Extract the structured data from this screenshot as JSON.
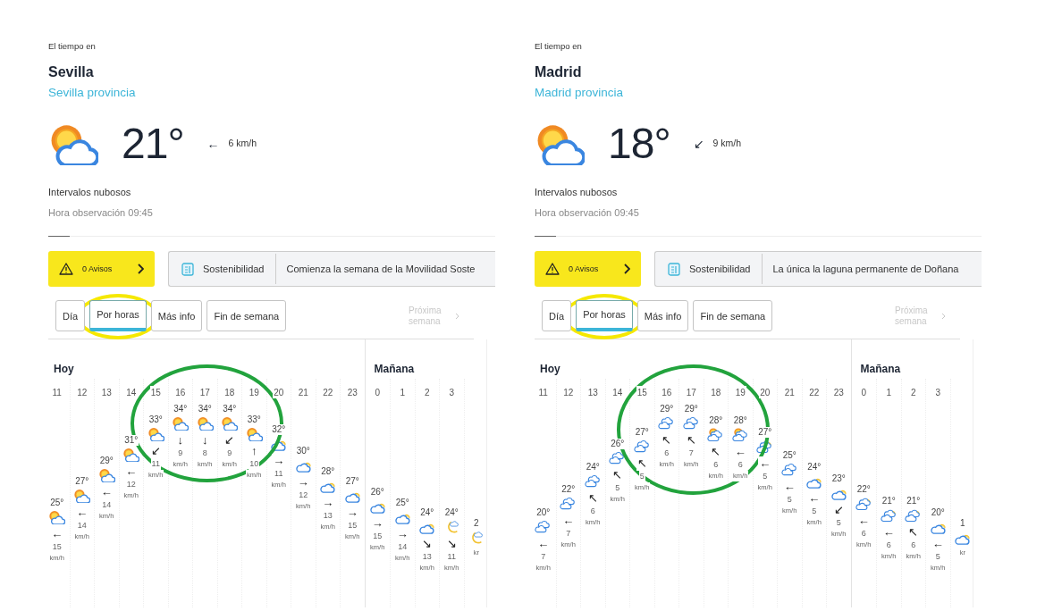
{
  "panels": [
    {
      "label": "El tiempo en",
      "city": "Sevilla",
      "province": "Sevilla provincia",
      "current": {
        "kind": "partly",
        "temp": "21°",
        "wind_arrow": "←",
        "wind": "6 km/h",
        "condition": "Intervalos nubosos",
        "observation": "Hora observación 09:45"
      },
      "alerts": {
        "text": "0 Avisos"
      },
      "news": {
        "category": "Sostenibilidad",
        "headline": "Comienza la semana de la Movilidad Soste"
      },
      "tabs": [
        {
          "label": "Día",
          "selected": false,
          "circled": false
        },
        {
          "label": "Por horas",
          "selected": true,
          "circled": true
        },
        {
          "label": "Más info",
          "selected": false,
          "circled": false
        },
        {
          "label": "Fin de semana",
          "selected": false,
          "circled": false
        }
      ],
      "next": {
        "label": "Próxima semana",
        "disabled": true
      },
      "days": [
        {
          "label": "Hoy",
          "hours": [
            {
              "hour": "11",
              "temp": "25°",
              "kind": "partly",
              "arrow": "←",
              "speed": "15",
              "unit": "km/h",
              "circled": false
            },
            {
              "hour": "12",
              "temp": "27°",
              "kind": "partly",
              "arrow": "←",
              "speed": "14",
              "unit": "km/h",
              "circled": false
            },
            {
              "hour": "13",
              "temp": "29°",
              "kind": "partly",
              "arrow": "←",
              "speed": "14",
              "unit": "km/h",
              "circled": false
            },
            {
              "hour": "14",
              "temp": "31°",
              "kind": "partly",
              "arrow": "←",
              "speed": "12",
              "unit": "km/h",
              "circled": false
            },
            {
              "hour": "15",
              "temp": "33°",
              "kind": "partly",
              "arrow": "↙",
              "speed": "11",
              "unit": "km/h",
              "circled": true
            },
            {
              "hour": "16",
              "temp": "34°",
              "kind": "partly",
              "arrow": "↓",
              "speed": "9",
              "unit": "km/h",
              "circled": true
            },
            {
              "hour": "17",
              "temp": "34°",
              "kind": "partly",
              "arrow": "↓",
              "speed": "8",
              "unit": "km/h",
              "circled": true
            },
            {
              "hour": "18",
              "temp": "34°",
              "kind": "partly",
              "arrow": "↙",
              "speed": "9",
              "unit": "km/h",
              "circled": true
            },
            {
              "hour": "19",
              "temp": "33°",
              "kind": "partly",
              "arrow": "↑",
              "speed": "10",
              "unit": "km/h",
              "circled": true
            },
            {
              "hour": "20",
              "temp": "32°",
              "kind": "few",
              "arrow": "→",
              "speed": "11",
              "unit": "km/h",
              "circled": false
            },
            {
              "hour": "21",
              "temp": "30°",
              "kind": "few",
              "arrow": "→",
              "speed": "12",
              "unit": "km/h",
              "circled": false
            },
            {
              "hour": "22",
              "temp": "28°",
              "kind": "few",
              "arrow": "→",
              "speed": "13",
              "unit": "km/h",
              "circled": false
            },
            {
              "hour": "23",
              "temp": "27°",
              "kind": "few",
              "arrow": "→",
              "speed": "15",
              "unit": "km/h",
              "circled": false
            }
          ]
        },
        {
          "label": "Mañana",
          "hours": [
            {
              "hour": "0",
              "temp": "26°",
              "kind": "few",
              "arrow": "→",
              "speed": "15",
              "unit": "km/h",
              "circled": false
            },
            {
              "hour": "1",
              "temp": "25°",
              "kind": "few",
              "arrow": "→",
              "speed": "14",
              "unit": "km/h",
              "circled": false
            },
            {
              "hour": "2",
              "temp": "24°",
              "kind": "few",
              "arrow": "↘",
              "speed": "13",
              "unit": "km/h",
              "circled": false
            },
            {
              "hour": "3",
              "temp": "24°",
              "kind": "night",
              "arrow": "↘",
              "speed": "11",
              "unit": "km/h",
              "circled": false
            },
            {
              "temp": "2",
              "kind": "night",
              "unit": "kr",
              "circled": false
            }
          ]
        }
      ]
    },
    {
      "label": "El tiempo en",
      "city": "Madrid",
      "province": "Madrid provincia",
      "current": {
        "kind": "partly",
        "temp": "18°",
        "wind_arrow": "↙",
        "wind": "9 km/h",
        "condition": "Intervalos nubosos",
        "observation": "Hora observación 09:45"
      },
      "alerts": {
        "text": "0 Avisos"
      },
      "news": {
        "category": "Sostenibilidad",
        "headline": "La única la laguna permanente de Doñana"
      },
      "tabs": [
        {
          "label": "Día",
          "selected": false,
          "circled": false
        },
        {
          "label": "Por horas",
          "selected": true,
          "circled": true
        },
        {
          "label": "Más info",
          "selected": false,
          "circled": false
        },
        {
          "label": "Fin de semana",
          "selected": false,
          "circled": false
        }
      ],
      "next": {
        "label": "Próxima semana",
        "disabled": true
      },
      "days": [
        {
          "label": "Hoy",
          "hours": [
            {
              "hour": "11",
              "temp": "20°",
              "kind": "overcast",
              "arrow": "←",
              "speed": "7",
              "unit": "km/h",
              "circled": false
            },
            {
              "hour": "12",
              "temp": "22°",
              "kind": "overcast",
              "arrow": "←",
              "speed": "7",
              "unit": "km/h",
              "circled": false
            },
            {
              "hour": "13",
              "temp": "24°",
              "kind": "overcast",
              "arrow": "↖",
              "speed": "6",
              "unit": "km/h",
              "circled": false
            },
            {
              "hour": "14",
              "temp": "26°",
              "kind": "overcast",
              "arrow": "↖",
              "speed": "5",
              "unit": "km/h",
              "circled": false
            },
            {
              "hour": "15",
              "temp": "27°",
              "kind": "overcast",
              "arrow": "↖",
              "speed": "5",
              "unit": "km/h",
              "circled": true
            },
            {
              "hour": "16",
              "temp": "29°",
              "kind": "overcast",
              "arrow": "↖",
              "speed": "6",
              "unit": "km/h",
              "circled": true
            },
            {
              "hour": "17",
              "temp": "29°",
              "kind": "overcast",
              "arrow": "↖",
              "speed": "7",
              "unit": "km/h",
              "circled": true
            },
            {
              "hour": "18",
              "temp": "28°",
              "kind": "sun-overcast",
              "arrow": "↖",
              "speed": "6",
              "unit": "km/h",
              "circled": true
            },
            {
              "hour": "19",
              "temp": "28°",
              "kind": "sun-overcast",
              "arrow": "←",
              "speed": "6",
              "unit": "km/h",
              "circled": true
            },
            {
              "hour": "20",
              "temp": "27°",
              "kind": "few-overcast",
              "arrow": "←",
              "speed": "5",
              "unit": "km/h",
              "circled": false
            },
            {
              "hour": "21",
              "temp": "25°",
              "kind": "overcast",
              "arrow": "←",
              "speed": "5",
              "unit": "km/h",
              "circled": false
            },
            {
              "hour": "22",
              "temp": "24°",
              "kind": "few",
              "arrow": "←",
              "speed": "5",
              "unit": "km/h",
              "circled": false
            },
            {
              "hour": "23",
              "temp": "23°",
              "kind": "few",
              "arrow": "↙",
              "speed": "5",
              "unit": "km/h",
              "circled": false
            }
          ]
        },
        {
          "label": "Mañana",
          "hours": [
            {
              "hour": "0",
              "temp": "22°",
              "kind": "few-overcast",
              "arrow": "←",
              "speed": "6",
              "unit": "km/h",
              "circled": false
            },
            {
              "hour": "1",
              "temp": "21°",
              "kind": "few-overcast",
              "arrow": "←",
              "speed": "6",
              "unit": "km/h",
              "circled": false
            },
            {
              "hour": "2",
              "temp": "21°",
              "kind": "few-overcast",
              "arrow": "↖",
              "speed": "6",
              "unit": "km/h",
              "circled": false
            },
            {
              "hour": "3",
              "temp": "20°",
              "kind": "few",
              "arrow": "←",
              "speed": "5",
              "unit": "km/h",
              "circled": false
            },
            {
              "temp": "1",
              "kind": "few",
              "unit": "kr",
              "circled": false
            }
          ]
        }
      ]
    }
  ]
}
